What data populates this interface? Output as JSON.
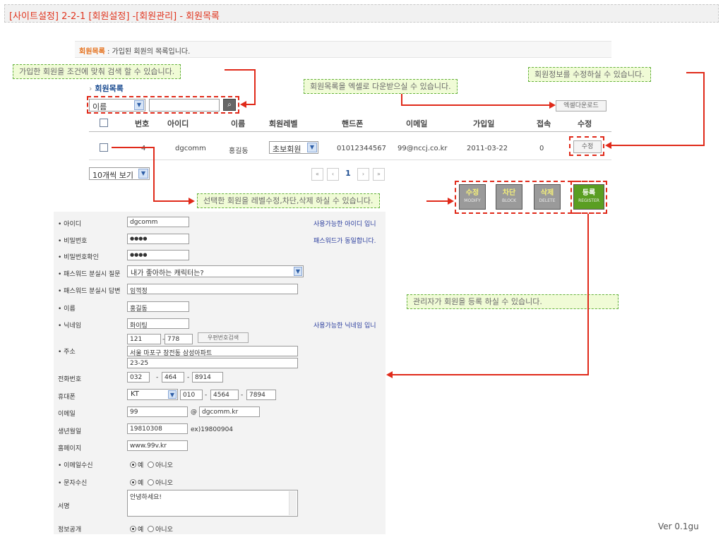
{
  "header": {
    "title": "[사이트설정] 2-2-1 [회원설정] -[회원관리] - 회원목록"
  },
  "description": {
    "label": "회원목록",
    "text": " : 가입된 회원의 목록입니다."
  },
  "callouts": {
    "search": "가입한 회원을 조건에 맞춰 검색 할 수 있습니다.",
    "excel": "회원목록을 엑셀로 다운받으실 수 있습니다.",
    "edit": "회원정보를 수정하실 수 있습니다.",
    "level": "선택한 회원을 레벨수정,차단,삭제 하실 수 있습니다.",
    "register": "관리자가 회원을 등록 하실 수 있습니다."
  },
  "list": {
    "section_title": "회원목록",
    "search_select": "이름",
    "search_value": "",
    "excel_button": "엑셀다운로드",
    "columns": [
      "번호",
      "아이디",
      "이름",
      "회원레벨",
      "핸드폰",
      "이메일",
      "가입일",
      "접속",
      "수정"
    ],
    "rows": [
      {
        "no": "4",
        "id": "dgcomm",
        "name": "홍길동",
        "level": "초보회원",
        "phone": "01012344567",
        "email": "99@nccj.co.kr",
        "joined": "2011-03-22",
        "visits": "0",
        "edit": "수정"
      }
    ],
    "page_size": "10개씩 보기",
    "pager": {
      "first": "«",
      "prev": "‹",
      "current": "1",
      "next": "›",
      "last": "»"
    }
  },
  "actions": [
    {
      "label": "수정",
      "sub": "MODIFY",
      "color": "#9a9a9a"
    },
    {
      "label": "차단",
      "sub": "BLOCK",
      "color": "#9a9a9a"
    },
    {
      "label": "삭제",
      "sub": "DELETE",
      "color": "#9a9a9a"
    },
    {
      "label": "등록",
      "sub": "REGISTER",
      "color": "#5a9e22"
    }
  ],
  "form": {
    "id_label": "• 아이디",
    "id_value": "dgcomm",
    "id_note": "사용가능한 아이디 입니",
    "pw_label": "• 비밀번호",
    "pw_value": "●●●●",
    "pw_note": "패스워드가 동일합니다.",
    "pw2_label": "• 비밀번호확인",
    "pw2_value": "●●●●",
    "q_label": "• 패스워드 분실시 질문",
    "q_value": "내가 좋아하는 캐릭터는?",
    "a_label": "• 패스워드 분실시 답변",
    "a_value": "임꺽정",
    "name_label": "• 이름",
    "name_value": "홍길동",
    "nick_label": "• 닉네임",
    "nick_value": "화이팅",
    "nick_note": "사용가능한 닉네임 입니",
    "addr_label": "• 주소",
    "zip1": "121",
    "zip2": "778",
    "zip_sep": "-",
    "zip_button": "우편번호검색",
    "addr1": "서울 마포구 창전동 삼성아파트",
    "addr2": "23-25",
    "tel_label": "전화번호",
    "tel1": "032",
    "tel2": "464",
    "tel3": "8914",
    "mobile_label": "휴대폰",
    "carrier": "KT",
    "mob1": "010",
    "mob2": "4564",
    "mob3": "7894",
    "email_label": "이메일",
    "email_id": "99",
    "email_at": "@",
    "email_domain": "dgcomm.kr",
    "birth_label": "생년월일",
    "birth_value": "19810308",
    "birth_hint": "ex)19800904",
    "home_label": "홈페이지",
    "home_value": "www.99v.kr",
    "email_rcv_label": "• 이메일수신",
    "sms_rcv_label": "• 문자수신",
    "sign_label": "서명",
    "sign_value": "안녕하세요!",
    "public_label": "정보공개",
    "yes": "예",
    "no": "아니오"
  },
  "version": "Ver 0.1gu"
}
